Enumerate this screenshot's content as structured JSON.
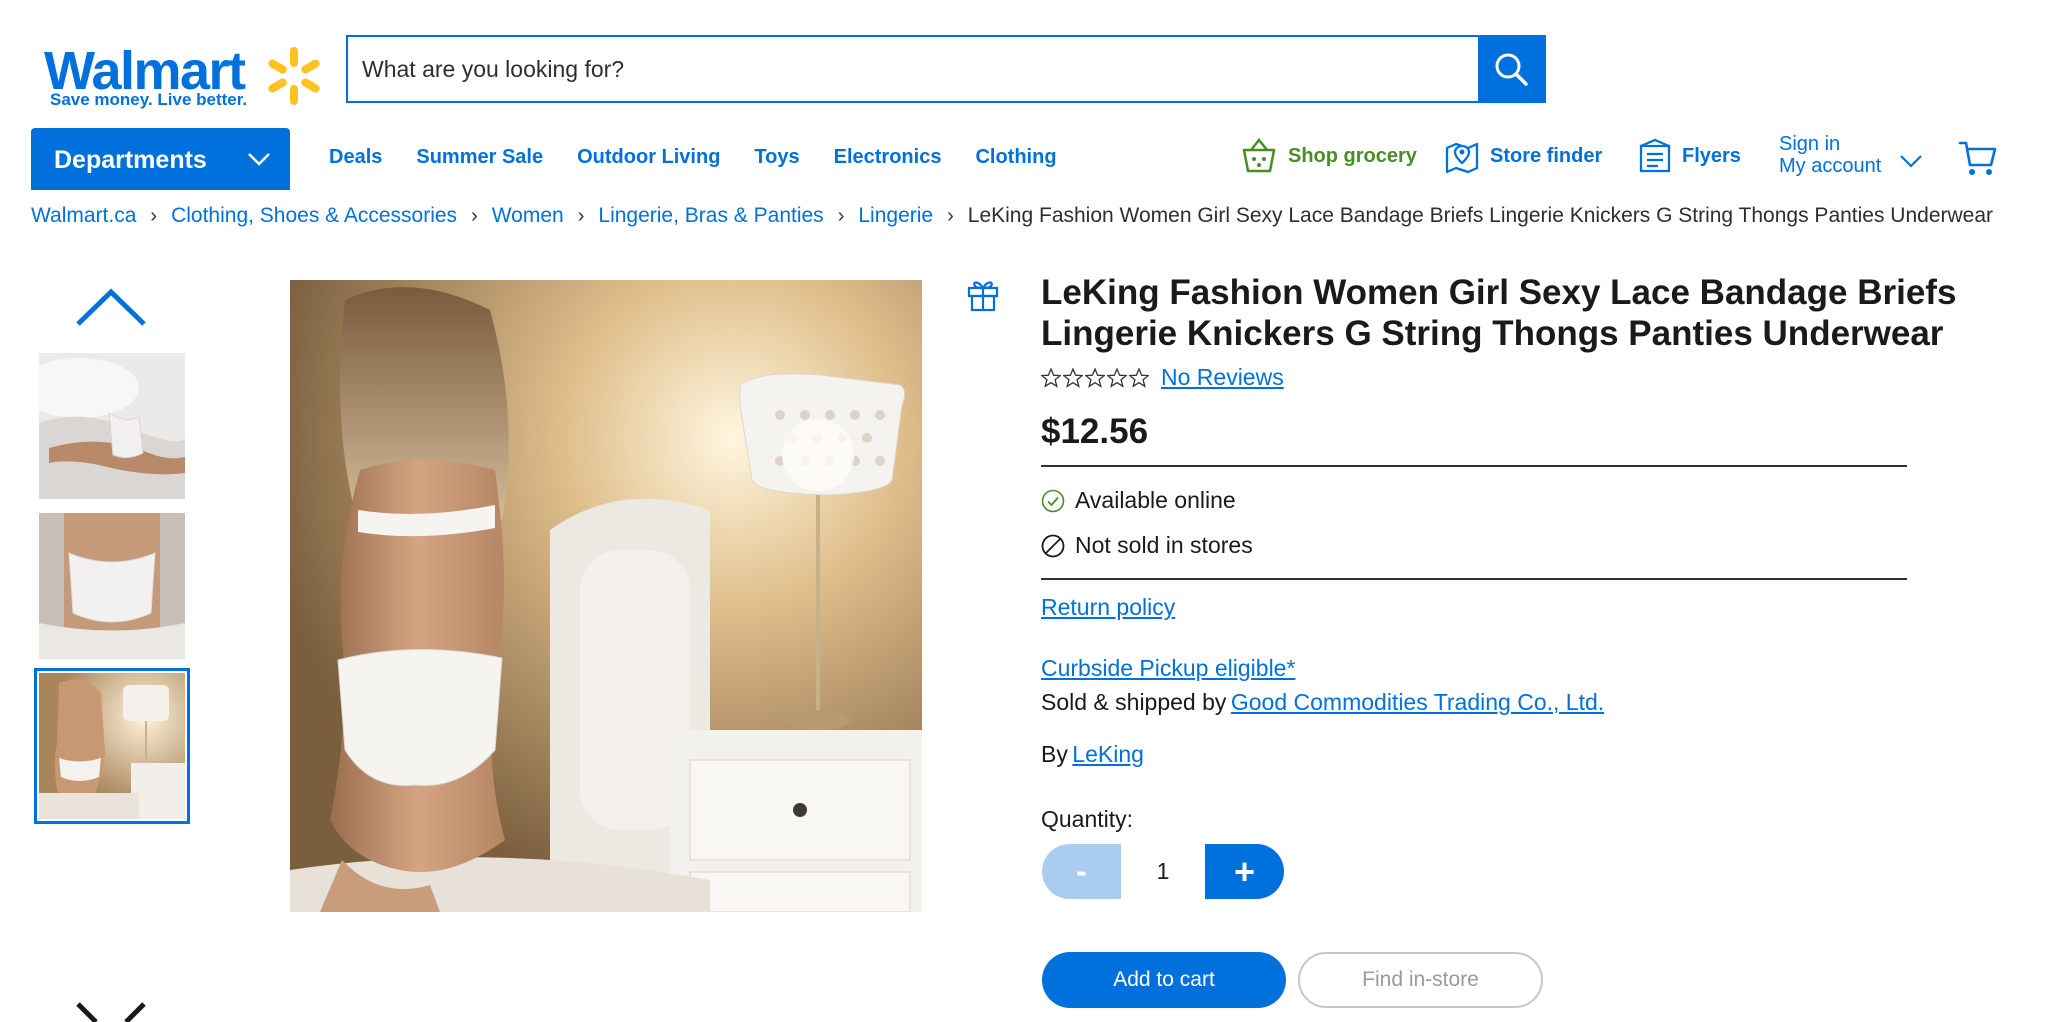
{
  "header": {
    "logo_word": "Walmart",
    "logo_tagline": "Save money. Live better.",
    "search_placeholder": "What are you looking for?"
  },
  "nav": {
    "departments_label": "Departments",
    "links": [
      "Deals",
      "Summer Sale",
      "Outdoor Living",
      "Toys",
      "Electronics",
      "Clothing"
    ],
    "shop_grocery": "Shop grocery",
    "store_finder": "Store finder",
    "flyers": "Flyers",
    "sign_in": "Sign in",
    "my_account": "My account"
  },
  "breadcrumb": {
    "items": [
      "Walmart.ca",
      "Clothing, Shoes & Accessories",
      "Women",
      "Lingerie, Bras & Panties",
      "Lingerie"
    ],
    "current": "LeKing Fashion Women Girl Sexy Lace Bandage Briefs Lingerie Knickers G String Thongs Panties Underwear"
  },
  "gallery": {
    "thumbnail_count": 3,
    "selected_index": 2
  },
  "product": {
    "title": "LeKing Fashion Women Girl Sexy Lace Bandage Briefs Lingerie Knickers G String Thongs Panties Underwear",
    "rating_stars": 0,
    "reviews_label": "No Reviews",
    "price": "$12.56",
    "available_online": "Available online",
    "not_sold_in_stores": "Not sold in stores",
    "return_policy": "Return policy",
    "curbside": "Curbside Pickup eligible*",
    "sold_by_prefix": "Sold & shipped by",
    "seller": "Good Commodities Trading Co., Ltd.",
    "by_prefix": "By",
    "brand": "LeKing"
  },
  "quantity": {
    "label": "Quantity:",
    "minus": "-",
    "value": "1",
    "plus": "+"
  },
  "actions": {
    "add_to_cart": "Add to cart",
    "find_in_store": "Find in-store"
  },
  "colors": {
    "brand_blue": "#0071dc",
    "spark_yellow": "#ffc220",
    "grocery_green": "#4a8d27",
    "disabled_blue": "#a9ccef"
  }
}
